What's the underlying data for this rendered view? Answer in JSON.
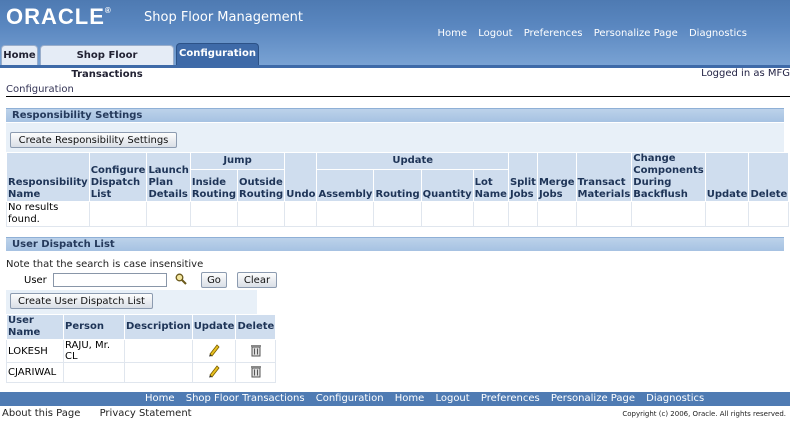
{
  "brand": {
    "logo": "ORACLE",
    "app_name": "Shop Floor Management"
  },
  "global_links": [
    "Home",
    "Logout",
    "Preferences",
    "Personalize Page",
    "Diagnostics"
  ],
  "tabs": [
    {
      "label": "Home"
    },
    {
      "label": "Shop Floor Transactions"
    },
    {
      "label": "Configuration"
    }
  ],
  "logged_in": "Logged in as  MFG",
  "page_title": "Configuration",
  "responsibility": {
    "section_title": "Responsibility Settings",
    "create_button": "Create Responsibility Settings",
    "group_jump": "Jump",
    "group_update": "Update",
    "cols": {
      "resp_name": "Responsibility Name",
      "configure_dispatch": "Configure Dispatch List",
      "launch_plan": "Launch Plan Details",
      "inside_routing": "Inside Routing",
      "outside_routing": "Outside Routing",
      "undo": "Undo",
      "assembly": "Assembly",
      "routing": "Routing",
      "quantity": "Quantity",
      "lot_name": "Lot Name",
      "split_jobs": "Split Jobs",
      "merge_jobs": "Merge Jobs",
      "transact_materials": "Transact Materials",
      "change_components": "Change Components During Backflush",
      "update": "Update",
      "delete": "Delete"
    },
    "empty_text": "No results found."
  },
  "dispatch": {
    "section_title": "User Dispatch List",
    "note": "Note that the search is case insensitive",
    "user_label": "User",
    "user_value": "",
    "go_button": "Go",
    "clear_button": "Clear",
    "create_button": "Create User Dispatch List",
    "cols": {
      "user_name": "User Name",
      "person": "Person",
      "description": "Description",
      "update": "Update",
      "delete": "Delete"
    },
    "rows": [
      {
        "user_name": "LOKESH",
        "person": "RAJU, Mr. CL",
        "description": ""
      },
      {
        "user_name": "CJARIWAL",
        "person": "",
        "description": ""
      }
    ]
  },
  "footer": {
    "links": [
      "Home",
      "Shop Floor Transactions",
      "Configuration",
      "Home",
      "Logout",
      "Preferences",
      "Personalize Page",
      "Diagnostics"
    ],
    "about": "About this Page",
    "privacy": "Privacy Statement",
    "copyright": "Copyright (c) 2006, Oracle. All rights reserved."
  }
}
